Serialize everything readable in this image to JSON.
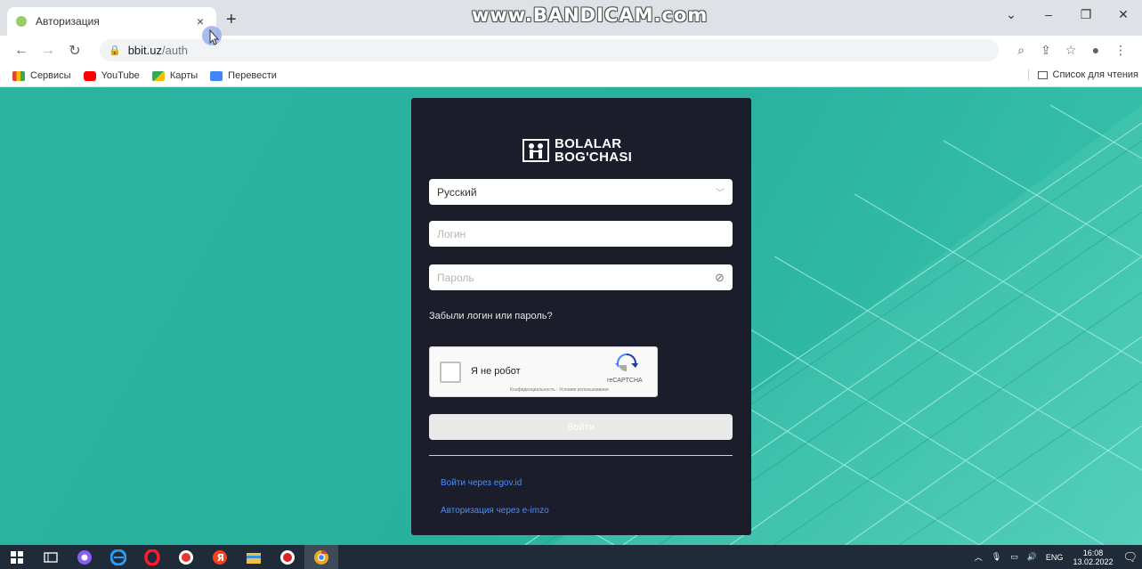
{
  "browser": {
    "tab_title": "Авторизация",
    "tab_close": "×",
    "new_tab": "+",
    "watermark": "www.BANDICAM.com",
    "url_host": "bbit.uz",
    "url_path": "/auth",
    "window_controls": [
      "⌄",
      "–",
      "❐",
      "✕"
    ]
  },
  "bookmarks": {
    "items": [
      {
        "label": "Сервисы",
        "color": "#e94235"
      },
      {
        "label": "YouTube",
        "color": "#ff0000"
      },
      {
        "label": "Карты",
        "color": "#34a853"
      },
      {
        "label": "Перевести",
        "color": "#4285f4"
      }
    ],
    "reading_list": "Список для чтения"
  },
  "login": {
    "logo_line1": "BOLALAR",
    "logo_line2": "BOG'CHASI",
    "language_value": "Русский",
    "login_placeholder": "Логин",
    "password_placeholder": "Пароль",
    "forgot_link": "Забыли логин или пароль?",
    "captcha_label": "Я не робот",
    "captcha_brand": "reCAPTCHA",
    "captcha_terms": "Конфиденциальность - Условия использования",
    "submit_label": "Войти",
    "egov_link": "Войти через egov.id",
    "eimzo_link": "Авторизация через e-imzo"
  },
  "taskbar": {
    "lang": "ENG",
    "time": "16:08",
    "date": "13.02.2022"
  },
  "colors": {
    "accent_link": "#4a8cff",
    "card_bg": "#1b1d2a",
    "page_bg": "#2bb4a0"
  }
}
